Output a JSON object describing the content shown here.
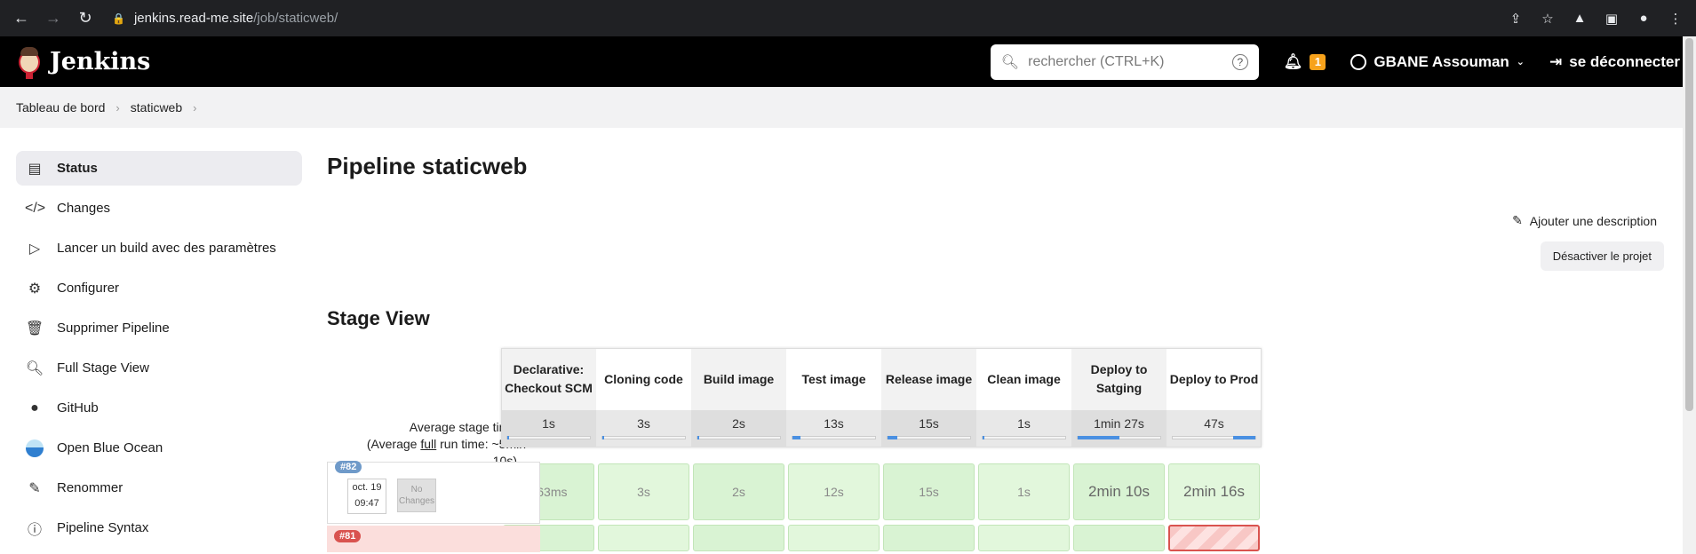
{
  "browser": {
    "url_host": "jenkins.read-me.site",
    "url_path": "/job/staticweb/"
  },
  "header": {
    "app_name": "Jenkins",
    "search_placeholder": "rechercher (CTRL+K)",
    "notifications_count": "1",
    "user_name": "GBANE Assouman",
    "logout": "se déconnecter"
  },
  "breadcrumb": [
    "Tableau de bord",
    "staticweb"
  ],
  "sidebar": {
    "items": [
      {
        "label": "Status",
        "icon": "status-icon"
      },
      {
        "label": "Changes",
        "icon": "code-icon"
      },
      {
        "label": "Lancer un build avec des paramètres",
        "icon": "play-icon"
      },
      {
        "label": "Configurer",
        "icon": "gear-icon"
      },
      {
        "label": "Supprimer Pipeline",
        "icon": "trash-icon"
      },
      {
        "label": "Full Stage View",
        "icon": "search-icon"
      },
      {
        "label": "GitHub",
        "icon": "github-icon"
      },
      {
        "label": "Open Blue Ocean",
        "icon": "blue-ocean-icon"
      },
      {
        "label": "Renommer",
        "icon": "pencil-icon"
      },
      {
        "label": "Pipeline Syntax",
        "icon": "help-icon"
      }
    ]
  },
  "main": {
    "title": "Pipeline staticweb",
    "add_description": "Ajouter une description",
    "disable_project": "Désactiver le projet",
    "stage_view_title": "Stage View"
  },
  "stage_view": {
    "avg_label_1": "Average stage times:",
    "avg_label_2a": "(Average ",
    "avg_label_2b": "full",
    "avg_label_2c": " run time: ~5min",
    "avg_label_3": "10s)",
    "stages": [
      {
        "name_1": "Declarative:",
        "name_2": "Checkout SCM",
        "avg": "1s",
        "avg_fill": 0.01
      },
      {
        "name_1": "Cloning code",
        "name_2": "",
        "avg": "3s",
        "avg_fill": 0.02
      },
      {
        "name_1": "Build image",
        "name_2": "",
        "avg": "2s",
        "avg_fill": 0.02
      },
      {
        "name_1": "Test image",
        "name_2": "",
        "avg": "13s",
        "avg_fill": 0.1
      },
      {
        "name_1": "Release image",
        "name_2": "",
        "avg": "15s",
        "avg_fill": 0.12
      },
      {
        "name_1": "Clean image",
        "name_2": "",
        "avg": "1s",
        "avg_fill": 0.01
      },
      {
        "name_1": "Deploy to",
        "name_2": "Satging",
        "avg": "1min 27s",
        "avg_fill": 0.5
      },
      {
        "name_1": "Deploy to Prod",
        "name_2": "",
        "avg": "47s",
        "avg_fill": 0.27
      }
    ],
    "builds": [
      {
        "number": "#82",
        "date": "oct. 19",
        "time": "09:47",
        "changes": "No Changes",
        "durations": [
          "863ms",
          "3s",
          "2s",
          "12s",
          "15s",
          "1s",
          "2min 10s",
          "2min 16s"
        ]
      },
      {
        "number": "#81"
      }
    ]
  }
}
